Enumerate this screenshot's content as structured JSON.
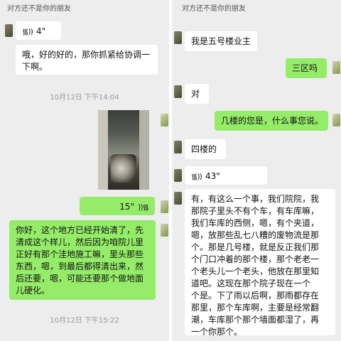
{
  "left": {
    "notice": "对方还不是你的朋友",
    "voice_in_duration": "4\"",
    "msg_reply": "哦，好的好的，那你抓紧给协调一\n下啊。",
    "time_1": "10月12日 下午14:04",
    "voice_out_duration": "15\"",
    "msg_long": "你好，这个地方已经开始清了，先\n清成这个样儿，然后因为咱院儿里\n正好有那个洼地施工嘛，里头那些\n东西，嗯，到最后都得清出来，然\n后还要，嗯，可能还要那个做地面\n儿硬化。",
    "time_2": "10月12日 下午15:22"
  },
  "right": {
    "notice": "对方还不是你的朋友",
    "msg_1": "我是五号楼业主",
    "msg_2": "三区吗",
    "msg_3": "对",
    "msg_4": "几楼的您是，什么事您说。",
    "msg_5": "四楼的",
    "voice_in_duration": "43\"",
    "msg_long": "有，有这么一个事，我们院院，我\n那院子里头不有个车，有车库嘛，\n我们车库的西侧，嗯，有个夹道，\n嗯，放那些乱七八糟的废物流是那\n个。那是几号楼，就是反正我们那\n个门口冲着的那个楼，那个老老一\n个老头儿一个老头，他放在那里知\n道吧。这现在那个院子现在一个\n个是。下了雨以后啊，那雨都存在\n那里，那个车库啊，主要是经常翻\n潮，车库那个那个墙面都湿了，再\n一个你那个。"
  },
  "icons": {
    "voice_wave": "◌)))",
    "voice_wave_out": "((( "
  }
}
